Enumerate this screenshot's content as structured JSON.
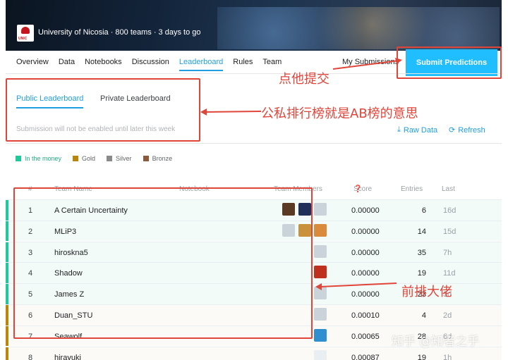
{
  "banner": {
    "logo_text": "UNIC",
    "host_line": "University of Nicosia · 800 teams · 3 days to go"
  },
  "tabs": [
    "Overview",
    "Data",
    "Notebooks",
    "Discussion",
    "Leaderboard",
    "Rules",
    "Team"
  ],
  "active_tab": "Leaderboard",
  "my_submissions": "My Submissions",
  "submit_button": "Submit Predictions",
  "subtabs": {
    "public": "Public Leaderboard",
    "private": "Private Leaderboard"
  },
  "notice": "Submission will not be enabled until later this week",
  "actions": {
    "raw_data": "Raw Data",
    "refresh": "Refresh"
  },
  "legend": [
    {
      "label": "In the money",
      "color": "#20c997"
    },
    {
      "label": "Gold",
      "color": "#b8860b"
    },
    {
      "label": "Silver",
      "color": "#8a8a8a"
    },
    {
      "label": "Bronze",
      "color": "#8b5a3c"
    }
  ],
  "columns": {
    "rank": "#",
    "team": "Team Name",
    "notebook": "Notebook",
    "members": "Team Members",
    "score": "Score",
    "entries": "Entries",
    "last": "Last"
  },
  "rows": [
    {
      "rank": "1",
      "name": "A Certain Uncertainty",
      "score": "0.00000",
      "entries": "6",
      "last": "16d",
      "medal": "#20c997"
    },
    {
      "rank": "2",
      "name": "MLiP3",
      "score": "0.00000",
      "entries": "14",
      "last": "15d",
      "medal": "#20c997"
    },
    {
      "rank": "3",
      "name": "hiroskna5",
      "score": "0.00000",
      "entries": "35",
      "last": "7h",
      "medal": "#20c997"
    },
    {
      "rank": "4",
      "name": "Shadow",
      "score": "0.00000",
      "entries": "19",
      "last": "11d",
      "medal": "#20c997"
    },
    {
      "rank": "5",
      "name": "James Z",
      "score": "0.00000",
      "entries": "23",
      "last": "3d",
      "medal": "#20c997"
    },
    {
      "rank": "6",
      "name": "Duan_STU",
      "score": "0.00010",
      "entries": "4",
      "last": "2d",
      "medal": "#b8860b"
    },
    {
      "rank": "7",
      "name": "Seawolf",
      "score": "0.00065",
      "entries": "28",
      "last": "6d",
      "medal": "#b8860b"
    },
    {
      "rank": "8",
      "name": "hirayuki",
      "score": "0.00087",
      "entries": "19",
      "last": "1h",
      "medal": "#b8860b"
    }
  ],
  "annotations": {
    "click_submit": "点他提交",
    "ab_board": "公私排行榜就是AB榜的意思",
    "top_players": "前排大佬"
  },
  "watermark": "知乎 @知者之乎"
}
